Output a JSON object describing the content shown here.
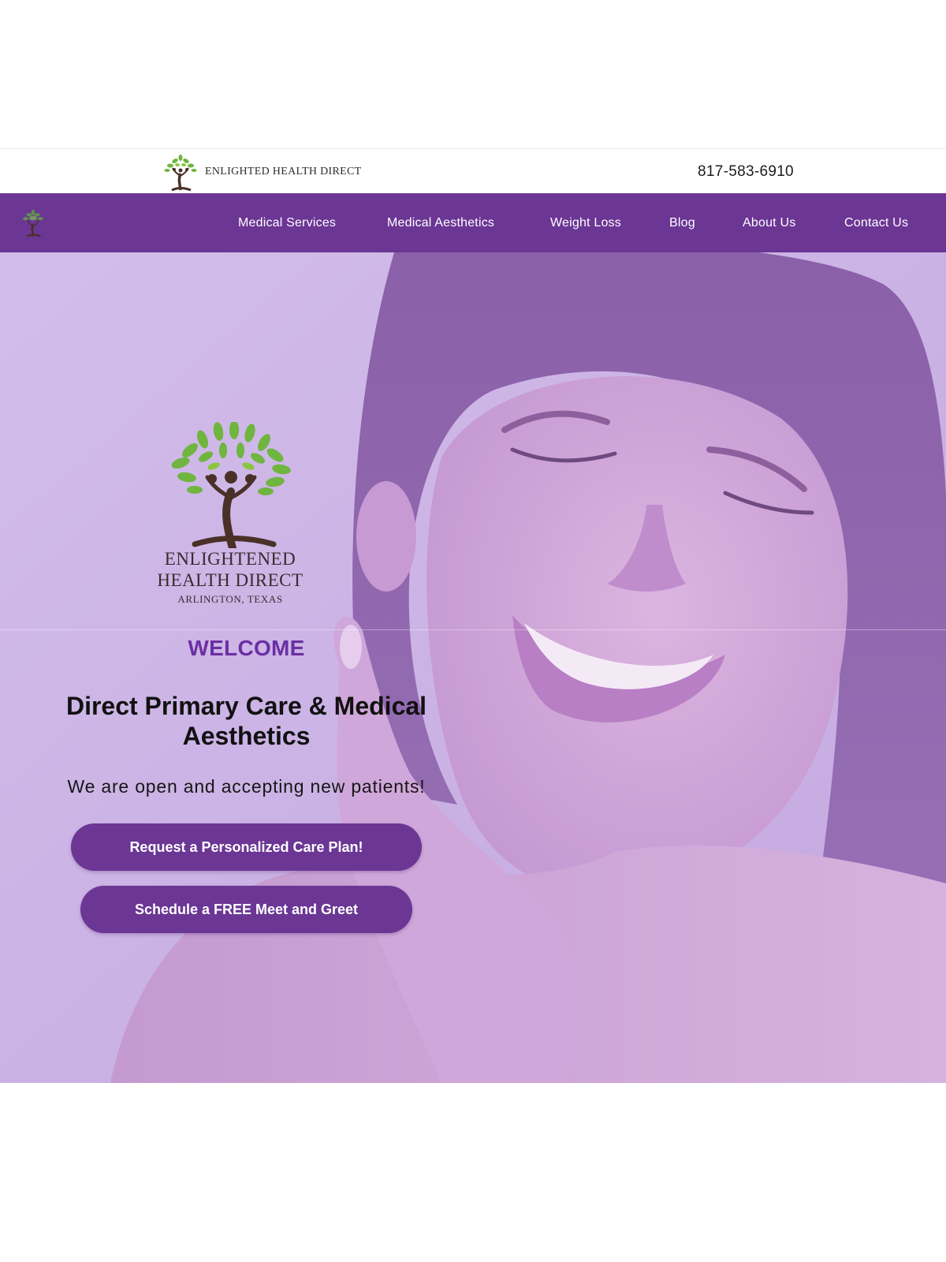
{
  "header": {
    "brand_name": "ENLIGHTED HEALTH DIRECT",
    "phone": "817-583-6910"
  },
  "nav": {
    "items": [
      {
        "label": "Medical Services"
      },
      {
        "label": "Medical Aesthetics"
      },
      {
        "label": "Weight Loss"
      },
      {
        "label": "Blog"
      },
      {
        "label": "About Us"
      },
      {
        "label": "Contact Us"
      }
    ]
  },
  "hero": {
    "logo": {
      "line1": "ENLIGHTENED",
      "line2": "HEALTH DIRECT",
      "line3": "ARLINGTON, TEXAS"
    },
    "welcome": "WELCOME",
    "headline": "Direct Primary Care & Medical Aesthetics",
    "tagline": "We are open and accepting new patients!",
    "buttons": {
      "care_plan": "Request a Personalized Care Plan!",
      "meet_greet": "Schedule a FREE Meet and Greet"
    },
    "image_description_icon": "smiling-woman-photo"
  },
  "colors": {
    "brand_purple": "#6b3694",
    "welcome_purple": "#6b2fa3",
    "hero_overlay": "#cdb6e6",
    "leaf_green": "#6fb540",
    "trunk_brown": "#4a3027"
  }
}
